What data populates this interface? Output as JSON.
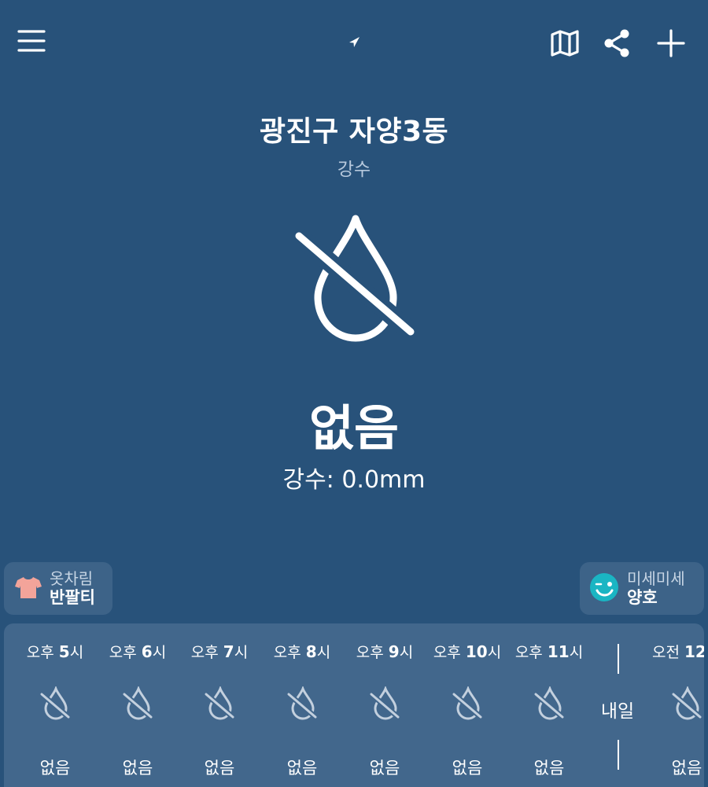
{
  "header": {
    "menu_icon": "menu-icon",
    "location_arrow_icon": "location-arrow-icon",
    "map_icon": "map-icon",
    "share_icon": "share-icon",
    "add_icon": "plus-icon"
  },
  "location": {
    "name": "광진구 자양3동",
    "subtitle": "강수"
  },
  "current": {
    "icon": "no-rain-drop-icon",
    "status": "없음",
    "amount": "강수: 0.0mm"
  },
  "chips": {
    "clothing": {
      "icon": "tshirt-icon",
      "title": "옷차림",
      "value": "반팔티"
    },
    "dust": {
      "icon": "winking-face-icon",
      "title": "미세미세",
      "value": "양호"
    }
  },
  "hourly": {
    "hours": [
      {
        "period": "오후",
        "hour": "5",
        "unit": "시",
        "status": "없음"
      },
      {
        "period": "오후",
        "hour": "6",
        "unit": "시",
        "status": "없음"
      },
      {
        "period": "오후",
        "hour": "7",
        "unit": "시",
        "status": "없음"
      },
      {
        "period": "오후",
        "hour": "8",
        "unit": "시",
        "status": "없음"
      },
      {
        "period": "오후",
        "hour": "9",
        "unit": "시",
        "status": "없음"
      },
      {
        "period": "오후",
        "hour": "10",
        "unit": "시",
        "status": "없음"
      },
      {
        "period": "오후",
        "hour": "11",
        "unit": "시",
        "status": "없음"
      },
      {
        "period": "오전",
        "hour": "12",
        "unit": "",
        "status": "없음"
      }
    ],
    "day_label": "내일"
  },
  "colors": {
    "background": "#28527a",
    "panel": "#42678c",
    "chip": "#3d6388",
    "shirt": "#f3a49a",
    "face": "#1ab5c3"
  }
}
